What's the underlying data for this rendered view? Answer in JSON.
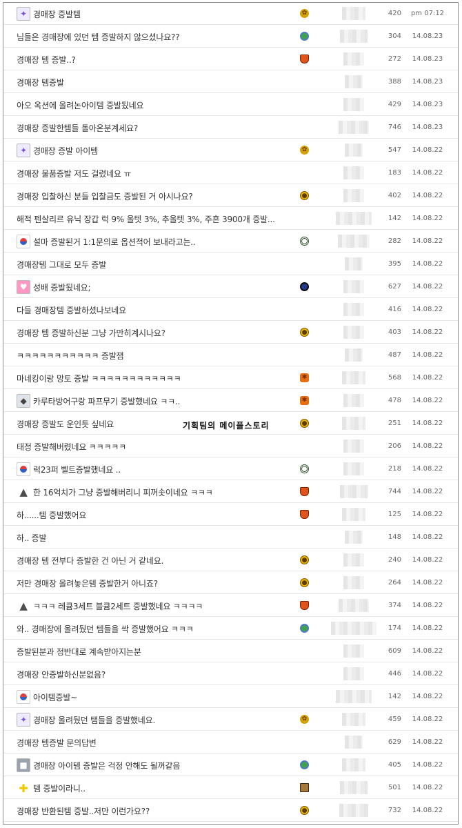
{
  "watermark": "기획팀의 메이플스토리",
  "rows": [
    {
      "title": "경매장 증발템",
      "avatar": "wizard",
      "level": "leaf",
      "views": "420",
      "date": "pm 07:12"
    },
    {
      "title": "님들은 경매장에 있던 템 증발하지 않으셨나요??",
      "avatar": "",
      "level": "globe",
      "views": "304",
      "date": "14.08.23"
    },
    {
      "title": "경매장 템 증발..?",
      "avatar": "",
      "level": "shield",
      "views": "272",
      "date": "14.08.23"
    },
    {
      "title": "경매장 템증발",
      "avatar": "",
      "level": "",
      "views": "388",
      "date": "14.08.23"
    },
    {
      "title": "아오 옥션에 올려논아이템 증발됬네요",
      "avatar": "",
      "level": "",
      "views": "429",
      "date": "14.08.23"
    },
    {
      "title": "경매장 증발한템들 돌아온분계세요?",
      "avatar": "",
      "level": "",
      "views": "746",
      "date": "14.08.23"
    },
    {
      "title": "경매장 증발 아이템",
      "avatar": "wizard",
      "level": "leaf",
      "views": "547",
      "date": "14.08.22"
    },
    {
      "title": "경매장 물품증발 저도 걸렸네요 ㅠ",
      "avatar": "",
      "level": "",
      "views": "183",
      "date": "14.08.22"
    },
    {
      "title": "경매장 입찰하신 분들 입찰금도 증발된 거 아시나요?",
      "avatar": "",
      "level": "gold",
      "views": "402",
      "date": "14.08.22"
    },
    {
      "title": "해적 펜살리르 유닉 장갑 럭 9% 올텟 3%, 추올텟 3%, 주흔 3900개 증발...",
      "avatar": "",
      "level": "",
      "views": "142",
      "date": "14.08.22"
    },
    {
      "title": "설마 증발된거 1:1문의로 옵션적어 보내라고는..",
      "avatar": "flag",
      "level": "eye",
      "views": "282",
      "date": "14.08.22"
    },
    {
      "title": "경매장템 그대로 모두 증발",
      "avatar": "",
      "level": "",
      "views": "395",
      "date": "14.08.22"
    },
    {
      "title": "성배 증발됬네요;",
      "avatar": "bunny",
      "level": "blue",
      "views": "627",
      "date": "14.08.22"
    },
    {
      "title": "다들 경매장템 증발하셨나보네요",
      "avatar": "",
      "level": "",
      "views": "416",
      "date": "14.08.22"
    },
    {
      "title": "경매장 템 증발하신분 그냥 가만히계시나요?",
      "avatar": "",
      "level": "gold",
      "views": "403",
      "date": "14.08.22"
    },
    {
      "title": "ㅋㅋㅋㅋㅋㅋㅋㅋㅋㅋㅋ 증발잼",
      "avatar": "",
      "level": "",
      "views": "487",
      "date": "14.08.22"
    },
    {
      "title": "마네킹이랑 망토 증발 ㅋㅋㅋㅋㅋㅋㅋㅋㅋㅋㅋㅋ",
      "avatar": "",
      "level": "crab",
      "views": "568",
      "date": "14.08.22"
    },
    {
      "title": "카루타방어구랑 파프무기 증발했네요 ㅋㅋ..",
      "avatar": "robot",
      "level": "crab",
      "views": "478",
      "date": "14.08.22"
    },
    {
      "title": "경매장 증발도 운인듯 싶네요",
      "avatar": "",
      "level": "gold",
      "views": "251",
      "date": "14.08.22"
    },
    {
      "title": "태정 증발해버렸네요 ㅋㅋㅋㅋㅋ",
      "avatar": "",
      "level": "",
      "views": "206",
      "date": "14.08.22"
    },
    {
      "title": "럭23퍼 벨트증발했네요 ..",
      "avatar": "flag",
      "level": "eye",
      "views": "218",
      "date": "14.08.22"
    },
    {
      "title": "한 16억치가 그냥 증발해버리니 피꺼솟이네요 ㅋㅋㅋ",
      "avatar": "hat",
      "level": "shield",
      "views": "744",
      "date": "14.08.22"
    },
    {
      "title": "하......템 증발했어요",
      "avatar": "",
      "level": "shield",
      "views": "125",
      "date": "14.08.22"
    },
    {
      "title": "하.. 증발",
      "avatar": "",
      "level": "",
      "views": "148",
      "date": "14.08.22"
    },
    {
      "title": "경매장 템 전부다 증발한 건 아닌 거 같네요.",
      "avatar": "",
      "level": "gold",
      "views": "240",
      "date": "14.08.22"
    },
    {
      "title": "저만 경매장 올려놓은템 증발한거 아니죠?",
      "avatar": "",
      "level": "gold",
      "views": "264",
      "date": "14.08.22"
    },
    {
      "title": "ㅋㅋㅋ 레큠3세트 블큠2세트 증발했네요 ㅋㅋㅋㅋ",
      "avatar": "hat",
      "level": "shield",
      "views": "374",
      "date": "14.08.22"
    },
    {
      "title": "와.. 경매장에 올려뒀던 템들을 싹 증발했어요 ㅋㅋㅋ",
      "avatar": "",
      "level": "globe",
      "views": "174",
      "date": "14.08.22"
    },
    {
      "title": "증발된분과 정반대로 계속받아지는분",
      "avatar": "",
      "level": "",
      "views": "609",
      "date": "14.08.22"
    },
    {
      "title": "경매장 안증발하신분없음?",
      "avatar": "",
      "level": "",
      "views": "446",
      "date": "14.08.22"
    },
    {
      "title": "아이템증발~",
      "avatar": "flag",
      "level": "",
      "views": "142",
      "date": "14.08.22"
    },
    {
      "title": "경매장 올려뒀던 탬들을 증발했네요.",
      "avatar": "wizard",
      "level": "leaf",
      "views": "459",
      "date": "14.08.22"
    },
    {
      "title": "경매장 템증발 문의답변",
      "avatar": "",
      "level": "",
      "views": "629",
      "date": "14.08.22"
    },
    {
      "title": "경매장 아이템 증발은 걱정 안해도 될꺼같음",
      "avatar": "cube",
      "level": "globe",
      "views": "405",
      "date": "14.08.22"
    },
    {
      "title": "템 증발이라니..",
      "avatar": "ribbon",
      "level": "gate",
      "views": "501",
      "date": "14.08.22"
    },
    {
      "title": "경매장 반환된템 증발..저만 이런가요??",
      "avatar": "",
      "level": "gold",
      "views": "732",
      "date": "14.08.22"
    }
  ]
}
